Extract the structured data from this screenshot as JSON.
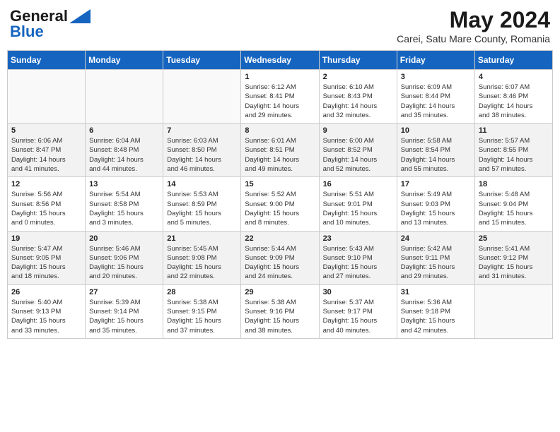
{
  "header": {
    "logo_line1": "General",
    "logo_line2": "Blue",
    "month_year": "May 2024",
    "location": "Carei, Satu Mare County, Romania"
  },
  "weekdays": [
    "Sunday",
    "Monday",
    "Tuesday",
    "Wednesday",
    "Thursday",
    "Friday",
    "Saturday"
  ],
  "weeks": [
    [
      {
        "day": "",
        "info": ""
      },
      {
        "day": "",
        "info": ""
      },
      {
        "day": "",
        "info": ""
      },
      {
        "day": "1",
        "info": "Sunrise: 6:12 AM\nSunset: 8:41 PM\nDaylight: 14 hours\nand 29 minutes."
      },
      {
        "day": "2",
        "info": "Sunrise: 6:10 AM\nSunset: 8:43 PM\nDaylight: 14 hours\nand 32 minutes."
      },
      {
        "day": "3",
        "info": "Sunrise: 6:09 AM\nSunset: 8:44 PM\nDaylight: 14 hours\nand 35 minutes."
      },
      {
        "day": "4",
        "info": "Sunrise: 6:07 AM\nSunset: 8:46 PM\nDaylight: 14 hours\nand 38 minutes."
      }
    ],
    [
      {
        "day": "5",
        "info": "Sunrise: 6:06 AM\nSunset: 8:47 PM\nDaylight: 14 hours\nand 41 minutes."
      },
      {
        "day": "6",
        "info": "Sunrise: 6:04 AM\nSunset: 8:48 PM\nDaylight: 14 hours\nand 44 minutes."
      },
      {
        "day": "7",
        "info": "Sunrise: 6:03 AM\nSunset: 8:50 PM\nDaylight: 14 hours\nand 46 minutes."
      },
      {
        "day": "8",
        "info": "Sunrise: 6:01 AM\nSunset: 8:51 PM\nDaylight: 14 hours\nand 49 minutes."
      },
      {
        "day": "9",
        "info": "Sunrise: 6:00 AM\nSunset: 8:52 PM\nDaylight: 14 hours\nand 52 minutes."
      },
      {
        "day": "10",
        "info": "Sunrise: 5:58 AM\nSunset: 8:54 PM\nDaylight: 14 hours\nand 55 minutes."
      },
      {
        "day": "11",
        "info": "Sunrise: 5:57 AM\nSunset: 8:55 PM\nDaylight: 14 hours\nand 57 minutes."
      }
    ],
    [
      {
        "day": "12",
        "info": "Sunrise: 5:56 AM\nSunset: 8:56 PM\nDaylight: 15 hours\nand 0 minutes."
      },
      {
        "day": "13",
        "info": "Sunrise: 5:54 AM\nSunset: 8:58 PM\nDaylight: 15 hours\nand 3 minutes."
      },
      {
        "day": "14",
        "info": "Sunrise: 5:53 AM\nSunset: 8:59 PM\nDaylight: 15 hours\nand 5 minutes."
      },
      {
        "day": "15",
        "info": "Sunrise: 5:52 AM\nSunset: 9:00 PM\nDaylight: 15 hours\nand 8 minutes."
      },
      {
        "day": "16",
        "info": "Sunrise: 5:51 AM\nSunset: 9:01 PM\nDaylight: 15 hours\nand 10 minutes."
      },
      {
        "day": "17",
        "info": "Sunrise: 5:49 AM\nSunset: 9:03 PM\nDaylight: 15 hours\nand 13 minutes."
      },
      {
        "day": "18",
        "info": "Sunrise: 5:48 AM\nSunset: 9:04 PM\nDaylight: 15 hours\nand 15 minutes."
      }
    ],
    [
      {
        "day": "19",
        "info": "Sunrise: 5:47 AM\nSunset: 9:05 PM\nDaylight: 15 hours\nand 18 minutes."
      },
      {
        "day": "20",
        "info": "Sunrise: 5:46 AM\nSunset: 9:06 PM\nDaylight: 15 hours\nand 20 minutes."
      },
      {
        "day": "21",
        "info": "Sunrise: 5:45 AM\nSunset: 9:08 PM\nDaylight: 15 hours\nand 22 minutes."
      },
      {
        "day": "22",
        "info": "Sunrise: 5:44 AM\nSunset: 9:09 PM\nDaylight: 15 hours\nand 24 minutes."
      },
      {
        "day": "23",
        "info": "Sunrise: 5:43 AM\nSunset: 9:10 PM\nDaylight: 15 hours\nand 27 minutes."
      },
      {
        "day": "24",
        "info": "Sunrise: 5:42 AM\nSunset: 9:11 PM\nDaylight: 15 hours\nand 29 minutes."
      },
      {
        "day": "25",
        "info": "Sunrise: 5:41 AM\nSunset: 9:12 PM\nDaylight: 15 hours\nand 31 minutes."
      }
    ],
    [
      {
        "day": "26",
        "info": "Sunrise: 5:40 AM\nSunset: 9:13 PM\nDaylight: 15 hours\nand 33 minutes."
      },
      {
        "day": "27",
        "info": "Sunrise: 5:39 AM\nSunset: 9:14 PM\nDaylight: 15 hours\nand 35 minutes."
      },
      {
        "day": "28",
        "info": "Sunrise: 5:38 AM\nSunset: 9:15 PM\nDaylight: 15 hours\nand 37 minutes."
      },
      {
        "day": "29",
        "info": "Sunrise: 5:38 AM\nSunset: 9:16 PM\nDaylight: 15 hours\nand 38 minutes."
      },
      {
        "day": "30",
        "info": "Sunrise: 5:37 AM\nSunset: 9:17 PM\nDaylight: 15 hours\nand 40 minutes."
      },
      {
        "day": "31",
        "info": "Sunrise: 5:36 AM\nSunset: 9:18 PM\nDaylight: 15 hours\nand 42 minutes."
      },
      {
        "day": "",
        "info": ""
      }
    ]
  ]
}
